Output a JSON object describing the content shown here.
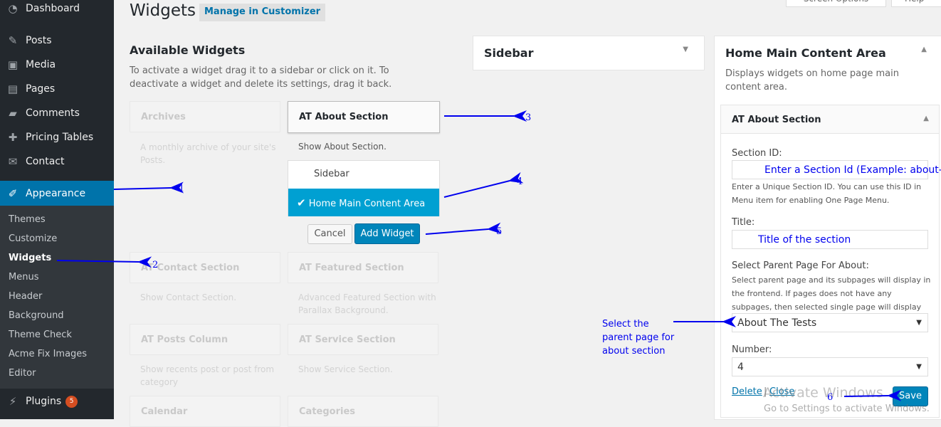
{
  "sidebar": {
    "items": [
      {
        "label": "Dashboard",
        "icon": "dashboard-icon"
      },
      {
        "label": "Posts",
        "icon": "pin-icon"
      },
      {
        "label": "Media",
        "icon": "media-icon"
      },
      {
        "label": "Pages",
        "icon": "pages-icon"
      },
      {
        "label": "Comments",
        "icon": "comment-icon"
      },
      {
        "label": "Pricing Tables",
        "icon": "plus-icon"
      },
      {
        "label": "Contact",
        "icon": "mail-icon"
      },
      {
        "label": "Appearance",
        "icon": "brush-icon"
      },
      {
        "label": "Plugins",
        "icon": "plugin-icon",
        "badge": "5"
      }
    ],
    "submenu": [
      "Themes",
      "Customize",
      "Widgets",
      "Menus",
      "Header",
      "Background",
      "Theme Check",
      "Acme Fix Images",
      "Editor"
    ]
  },
  "header": {
    "title": "Widgets",
    "customizer_button": "Manage in Customizer",
    "screen_options": "Screen Options",
    "help": "Help"
  },
  "available": {
    "title": "Available Widgets",
    "description": "To activate a widget drag it to a sidebar or click on it. To deactivate a widget and delete its settings, drag it back.",
    "widgets": [
      {
        "name": "Archives",
        "desc": "A monthly archive of your site's Posts."
      },
      {
        "name": "AT About Section",
        "desc": "Show About Section."
      },
      {
        "name": "AT Contact Section",
        "desc": "Show Contact Section."
      },
      {
        "name": "AT Featured Section",
        "desc": "Advanced Featured Section with Parallax Background."
      },
      {
        "name": "AT Posts Column",
        "desc": "Show recents post or post from category"
      },
      {
        "name": "AT Service Section",
        "desc": "Show Service Section."
      },
      {
        "name": "Calendar",
        "desc": ""
      },
      {
        "name": "Categories",
        "desc": ""
      }
    ],
    "chooser": {
      "options": [
        "Sidebar",
        "Home Main Content Area"
      ],
      "selected": "Home Main Content Area",
      "cancel": "Cancel",
      "add": "Add Widget"
    }
  },
  "sidebar_area": {
    "title": "Sidebar"
  },
  "home_area": {
    "title": "Home Main Content Area",
    "description": "Displays widgets on home page main content area.",
    "widget": {
      "title": "AT About Section",
      "section_id_label": "Section ID:",
      "section_id_value": "Enter a Section Id (Example: about-us)",
      "section_id_hint": "Enter a Unique Section ID. You can use this ID in Menu item for enabling One Page Menu.",
      "title_label": "Title:",
      "title_value": "Title of the section",
      "parent_label": "Select Parent Page For About:",
      "parent_hint": "Select parent page and its subpages will display in the frontend. If pages does not have any subpages, then selected single page will display",
      "parent_value": "About The Tests",
      "number_label": "Number:",
      "number_value": "4",
      "delete": "Delete",
      "close": "Close",
      "save": "Save"
    }
  },
  "annotations": {
    "n1": "1",
    "n2": "2",
    "n3": "3",
    "n4": "4",
    "n5": "5",
    "n6": "6",
    "note": "Select the parent page for about section",
    "color": "#0000ee"
  },
  "watermark": {
    "line1": "Activate Windows",
    "line2": "Go to Settings to activate Windows."
  },
  "colors": {
    "accent": "#0073aa",
    "highlight": "#00a0d2",
    "sidebar": "#23282d"
  }
}
